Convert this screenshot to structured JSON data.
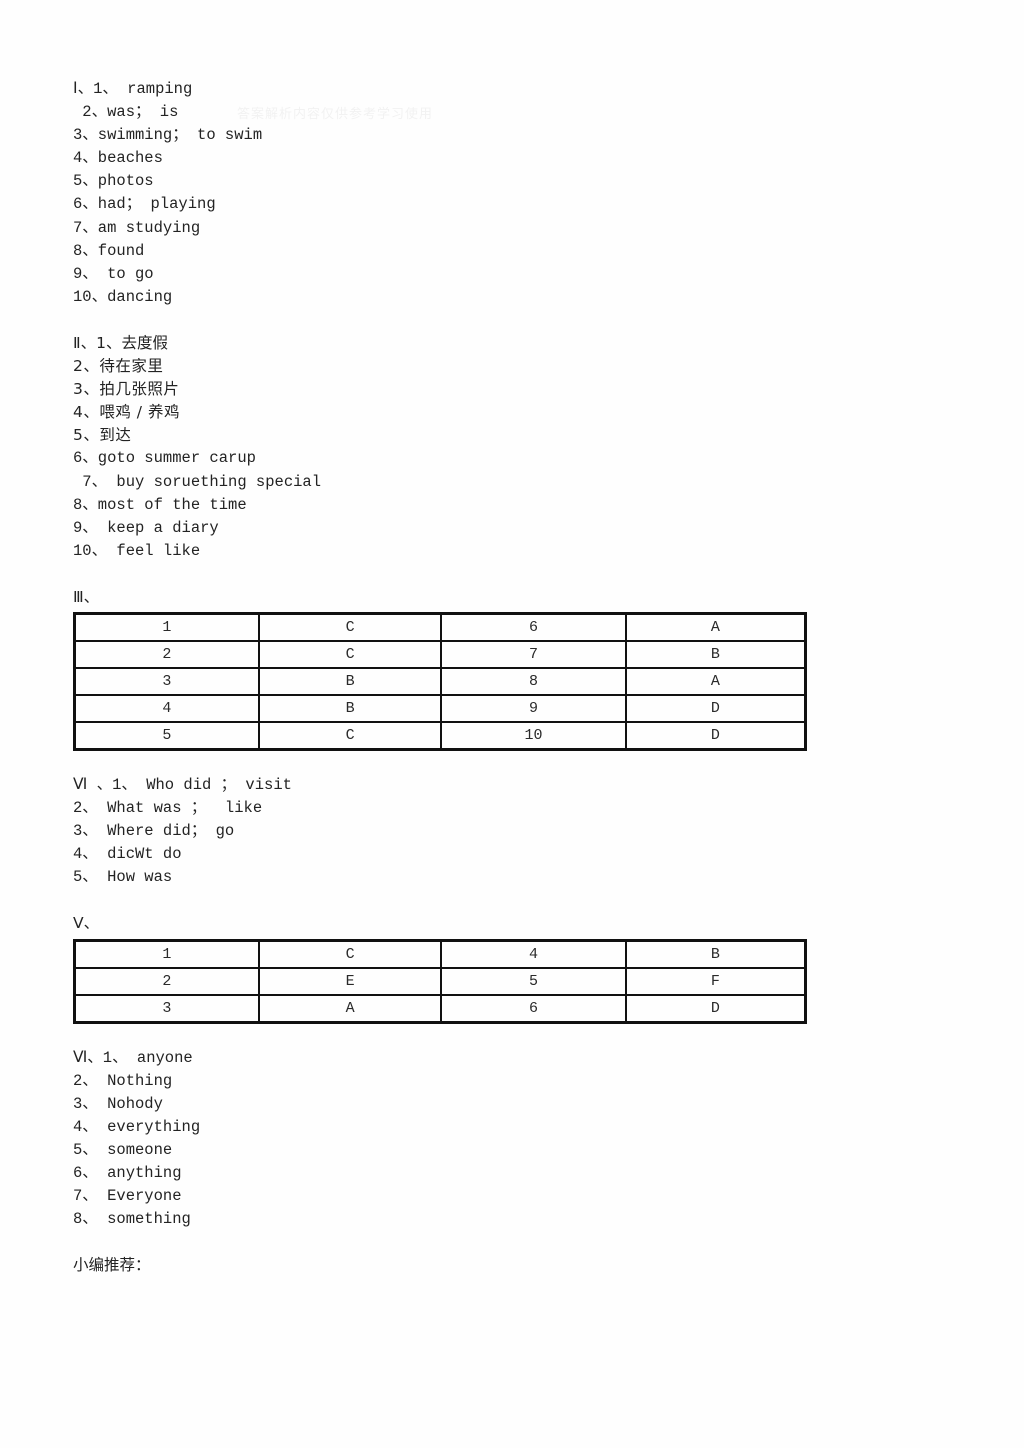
{
  "document": {
    "watermark_text": "答案解析内容仅供参考学习使用",
    "sections": [
      {
        "id": "section-1",
        "heading": "Ⅰ、1、 ramping",
        "lines": [
          " 2、was； is",
          "3、swimming； to swim",
          "4、beaches",
          "5、photos",
          "6、had； playing",
          "7、am studying",
          "8、found",
          "9、 to go",
          "10、dancing"
        ]
      },
      {
        "id": "section-2",
        "heading": "Ⅱ、1、去度假",
        "lines": [
          "2、待在家里",
          "3、拍几张照片",
          "4、喂鸡 / 养鸡",
          "5、到达",
          "6、goto summer carup",
          " 7、 buy soruething special",
          "8、most of the time",
          "9、 keep a diary",
          "10、 feel like"
        ]
      },
      {
        "id": "section-4",
        "heading": "Ⅵ 、1、 Who did ； visit",
        "lines": [
          "2、 What was ；  like",
          "3、 Where did； go",
          "4、 dicWt do",
          "5、 How was"
        ]
      },
      {
        "id": "section-6",
        "heading": "Ⅵ、1、 anyone",
        "lines": [
          "2、 Nothing",
          "3、 Nohody",
          "4、 everything",
          "5、 someone",
          "6、 anything",
          "7、 Everyone",
          "8、 something"
        ]
      }
    ],
    "table_sections": [
      {
        "id": "section-3",
        "heading": "Ⅲ、",
        "rows": [
          [
            "1",
            "C",
            "6",
            "A"
          ],
          [
            "2",
            "C",
            "7",
            "B"
          ],
          [
            "3",
            "B",
            "8",
            "A"
          ],
          [
            "4",
            "B",
            "9",
            "D"
          ],
          [
            "5",
            "C",
            "10",
            "D"
          ]
        ]
      },
      {
        "id": "section-5",
        "heading": "Ⅴ、",
        "rows": [
          [
            "1",
            "C",
            "4",
            "B"
          ],
          [
            "2",
            "E",
            "5",
            "F"
          ],
          [
            "3",
            "A",
            "6",
            "D"
          ]
        ]
      }
    ],
    "footer": "小编推荐："
  }
}
